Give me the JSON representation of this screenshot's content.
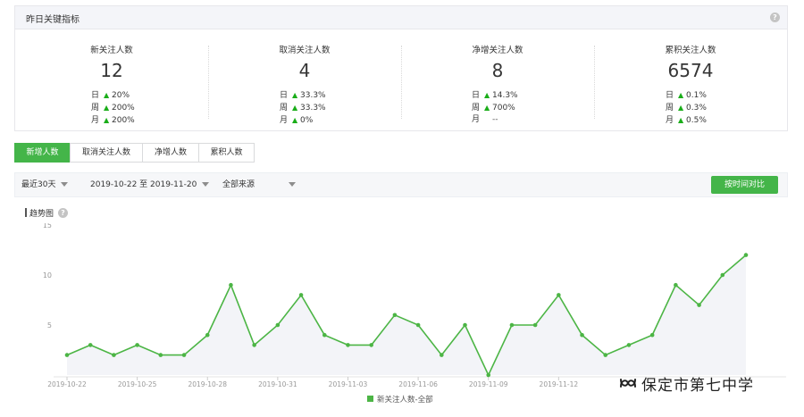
{
  "panel": {
    "title": "昨日关键指标",
    "help": "?"
  },
  "metrics": [
    {
      "label": "新关注人数",
      "value": "12",
      "rows": [
        {
          "period": "日",
          "arrow": "up",
          "pct": "20%"
        },
        {
          "period": "周",
          "arrow": "up",
          "pct": "200%"
        },
        {
          "period": "月",
          "arrow": "up",
          "pct": "200%"
        }
      ]
    },
    {
      "label": "取消关注人数",
      "value": "4",
      "rows": [
        {
          "period": "日",
          "arrow": "up",
          "pct": "33.3%"
        },
        {
          "period": "周",
          "arrow": "up",
          "pct": "33.3%"
        },
        {
          "period": "月",
          "arrow": "up",
          "pct": "0%"
        }
      ]
    },
    {
      "label": "净增关注人数",
      "value": "8",
      "rows": [
        {
          "period": "日",
          "arrow": "up",
          "pct": "14.3%"
        },
        {
          "period": "周",
          "arrow": "up",
          "pct": "700%"
        },
        {
          "period": "月",
          "arrow": "none",
          "pct": "--"
        }
      ]
    },
    {
      "label": "累积关注人数",
      "value": "6574",
      "rows": [
        {
          "period": "日",
          "arrow": "up",
          "pct": "0.1%"
        },
        {
          "period": "周",
          "arrow": "up",
          "pct": "0.3%"
        },
        {
          "period": "月",
          "arrow": "up",
          "pct": "0.5%"
        }
      ]
    }
  ],
  "tabs": [
    "新增人数",
    "取消关注人数",
    "净增人数",
    "累积人数"
  ],
  "filters": {
    "range": "最近30天",
    "dates": "2019-10-22 至 2019-11-20",
    "source": "全部来源",
    "compare_button": "按时间对比"
  },
  "chart_title": "趋势图",
  "colors": {
    "accent": "#44b549",
    "line": "#4cb545",
    "arrow_up": "#1aad19"
  },
  "chart_data": {
    "type": "line",
    "ylim": [
      0,
      15
    ],
    "yticks": [
      5,
      10,
      15
    ],
    "x": [
      "2019-10-22",
      "2019-10-23",
      "2019-10-24",
      "2019-10-25",
      "2019-10-26",
      "2019-10-27",
      "2019-10-28",
      "2019-10-29",
      "2019-10-30",
      "2019-10-31",
      "2019-11-01",
      "2019-11-02",
      "2019-11-03",
      "2019-11-04",
      "2019-11-05",
      "2019-11-06",
      "2019-11-07",
      "2019-11-08",
      "2019-11-09",
      "2019-11-10",
      "2019-11-11",
      "2019-11-12",
      "2019-11-13",
      "2019-11-14",
      "2019-11-15",
      "2019-11-16",
      "2019-11-17",
      "2019-11-18",
      "2019-11-19",
      "2019-11-20"
    ],
    "xtick_labels": [
      "2019-10-22",
      "2019-10-25",
      "2019-10-28",
      "2019-10-31",
      "2019-11-03",
      "2019-11-06",
      "2019-11-09",
      "2019-11-12"
    ],
    "series": [
      {
        "name": "新关注人数-全部",
        "values": [
          2,
          3,
          2,
          3,
          2,
          2,
          4,
          9,
          3,
          5,
          8,
          4,
          3,
          3,
          6,
          5,
          2,
          5,
          0,
          5,
          5,
          8,
          4,
          2,
          3,
          4,
          9,
          7,
          10,
          12
        ]
      }
    ],
    "grid": false,
    "legend": "bottom-center"
  },
  "watermark": {
    "text": "保定市第七中学",
    "icon": "wechat-channel-icon"
  }
}
